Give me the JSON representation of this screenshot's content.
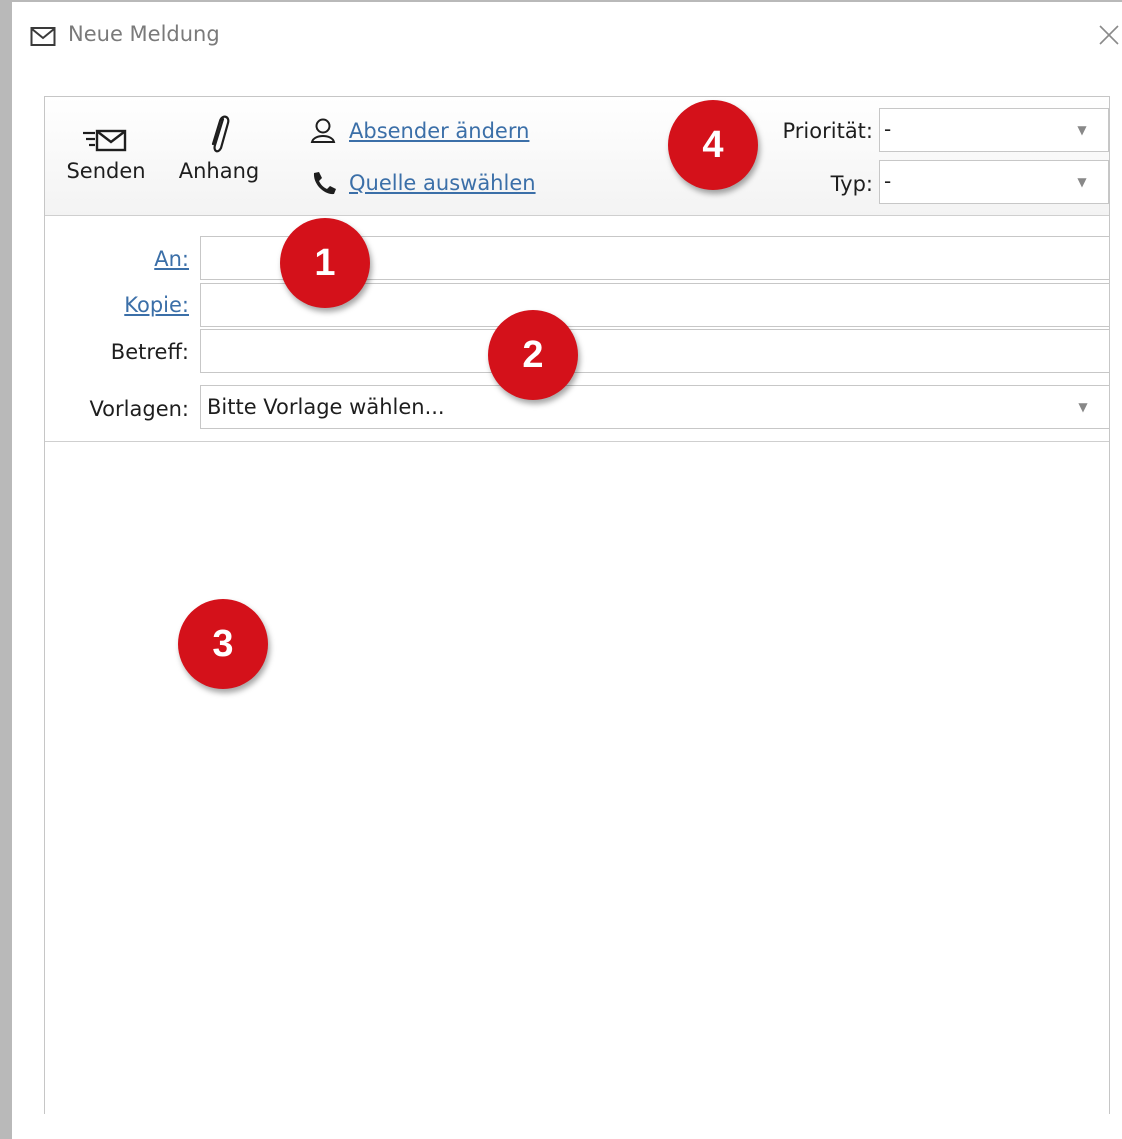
{
  "window": {
    "title": "Neue Meldung"
  },
  "toolbar": {
    "send_label": "Senden",
    "attach_label": "Anhang",
    "change_sender_label": "Absender ändern",
    "select_source_label": "Quelle auswählen",
    "priority_label": "Priorität:",
    "priority_value": "-",
    "type_label": "Typ:",
    "type_value": "-"
  },
  "form": {
    "to_label": "An:",
    "to_value": "",
    "cc_label": "Kopie:",
    "cc_value": "",
    "subject_label": "Betreff:",
    "subject_value": "",
    "templates_label": "Vorlagen:",
    "templates_value": "Bitte Vorlage wählen..."
  },
  "body": {
    "text": ""
  },
  "markers": [
    "1",
    "2",
    "3",
    "4"
  ],
  "colors": {
    "link": "#3b6fa8",
    "marker": "#d4111a"
  },
  "icons": {
    "title": "envelope-icon",
    "close": "close-icon",
    "send": "send-mail-icon",
    "attach": "paperclip-icon",
    "sender": "person-icon",
    "source": "phone-icon",
    "dropdown": "chevron-down-icon"
  }
}
